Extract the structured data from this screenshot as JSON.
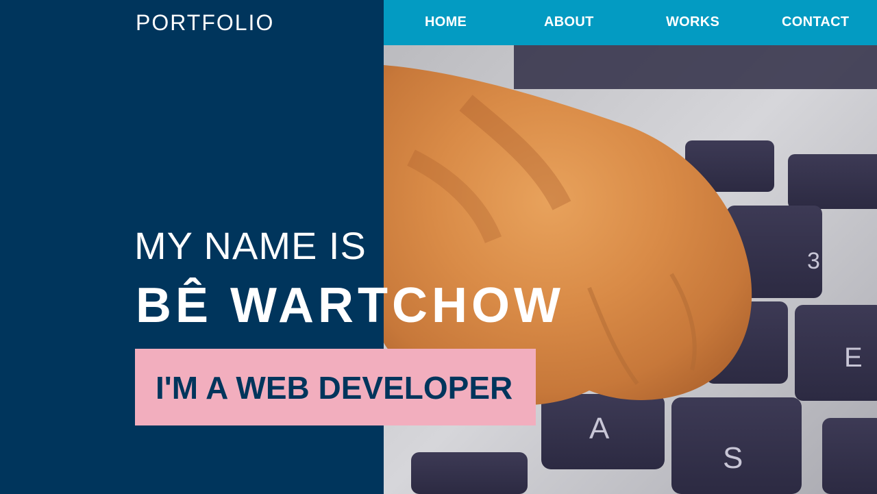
{
  "brand": {
    "title": "PORTFOLIO"
  },
  "nav": {
    "items": [
      {
        "label": "HOME"
      },
      {
        "label": "ABOUT"
      },
      {
        "label": "WORKS"
      },
      {
        "label": "CONTACT"
      }
    ]
  },
  "hero": {
    "intro": "MY NAME IS",
    "name": "BÊ WARTCHOW",
    "role": "I'M A WEB DEVELOPER"
  },
  "photo": {
    "keys": [
      "3",
      "E",
      "A",
      "S"
    ]
  },
  "colors": {
    "left_panel": "#00355c",
    "nav_bar": "#039bc2",
    "role_box": "#f2aebe",
    "role_text": "#00355c"
  }
}
